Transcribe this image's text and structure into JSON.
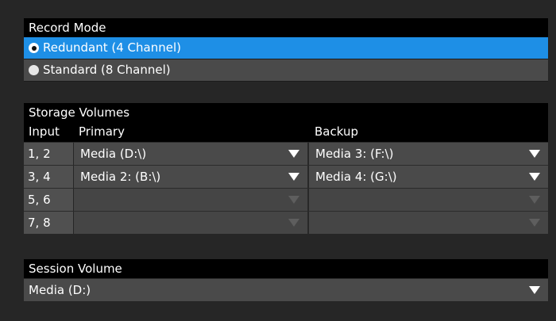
{
  "record_mode": {
    "title": "Record Mode",
    "options": [
      {
        "label": "Redundant (4 Channel)",
        "selected": true
      },
      {
        "label": "Standard (8 Channel)",
        "selected": false
      }
    ]
  },
  "storage": {
    "title": "Storage Volumes",
    "headers": {
      "input": "Input",
      "primary": "Primary",
      "backup": "Backup"
    },
    "rows": [
      {
        "input": "1, 2",
        "primary": "Media (D:\\)",
        "backup": "Media 3: (F:\\)"
      },
      {
        "input": "3, 4",
        "primary": "Media 2: (B:\\)",
        "backup": "Media 4: (G:\\)"
      },
      {
        "input": "5, 6",
        "primary": "",
        "backup": ""
      },
      {
        "input": "7, 8",
        "primary": "",
        "backup": ""
      }
    ]
  },
  "session": {
    "title": "Session Volume",
    "value": "Media (D:)"
  },
  "colors": {
    "accent": "#1e8fe6",
    "background": "#262626",
    "header": "#000000",
    "row": "#4a4a4a"
  }
}
